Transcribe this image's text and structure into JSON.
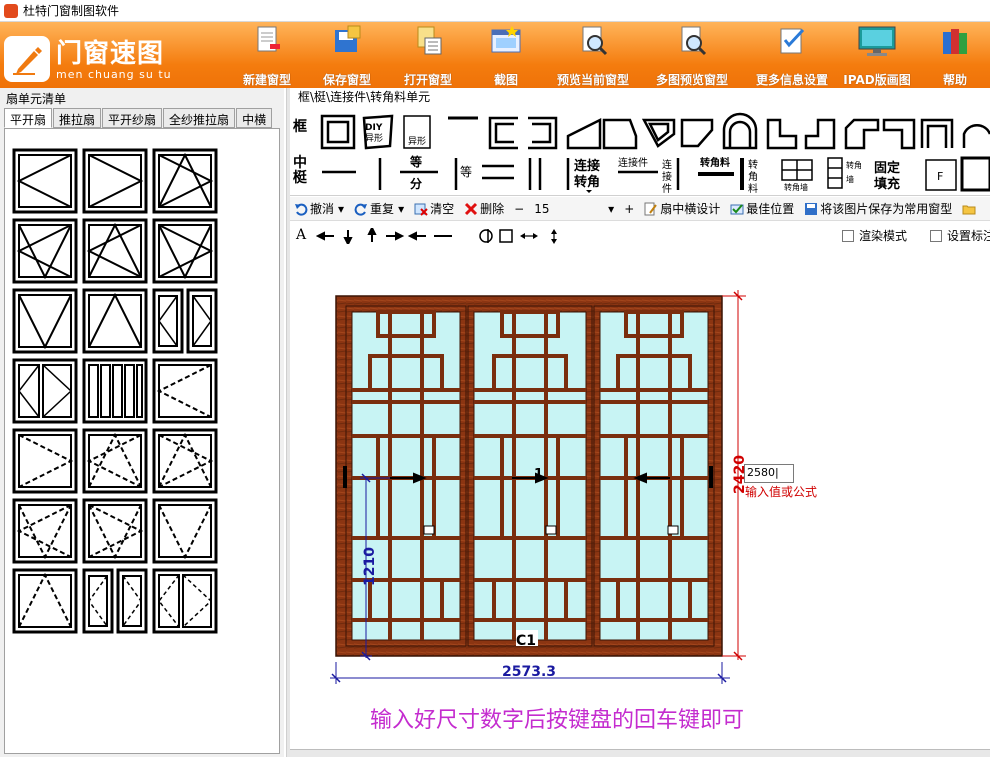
{
  "window": {
    "title": "杜特门窗制图软件"
  },
  "logo": {
    "cn": "门窗速图",
    "pinyin": "men chuang su tu"
  },
  "ribbon": [
    {
      "label": "新建窗型",
      "icon": "new-file-icon"
    },
    {
      "label": "保存窗型",
      "icon": "save-icon"
    },
    {
      "label": "打开窗型",
      "icon": "open-icon"
    },
    {
      "label": "截图",
      "icon": "screenshot-icon"
    },
    {
      "label": "预览当前窗型",
      "icon": "preview-icon"
    },
    {
      "label": "多图预览窗型",
      "icon": "multi-preview-icon"
    },
    {
      "label": "更多信息设置",
      "icon": "settings-icon"
    },
    {
      "label": "IPAD版画图",
      "icon": "ipad-icon"
    },
    {
      "label": "帮助",
      "icon": "help-books-icon"
    }
  ],
  "left": {
    "title": "扇单元清单",
    "tabs": [
      "平开扇",
      "推拉扇",
      "平开纱扇",
      "全纱推拉扇",
      "中横"
    ],
    "active_tab": 0
  },
  "profiles": {
    "title": "框\\梃\\连接件\\转角料单元",
    "row1_label": "框",
    "row2_label": "中梃",
    "diy_label": "DIY\n异形",
    "yixing_label": "异形",
    "deng_fen": "等分",
    "deng": "等",
    "lianjie_zhuanjiao": "连接转角",
    "lianjiejian": "连接件",
    "zhuanjiaoliao": "转角料",
    "zhuanjiaoqiang": "转角墙",
    "guding_tianchong": "固定填充",
    "f_label": "F"
  },
  "toolbar": {
    "undo": "撤消",
    "redo": "重复",
    "clear": "清空",
    "delete": "删除",
    "minus": "−",
    "value": "15",
    "plus": "+",
    "sash_design": "扇中横设计",
    "best_pos": "最佳位置",
    "save_common": "将该图片保存为常用窗型"
  },
  "drawtools": {
    "text_tool": "A",
    "render_mode": "渲染模式",
    "set_label": "设置标注"
  },
  "drawing": {
    "height_dim": "2420",
    "width_dim": "2573.3",
    "sash_dim": "1210",
    "input_value": "2580",
    "input_hint": "输入值或公式",
    "sash_mark": "1",
    "window_code": "C1",
    "instruction": "输入好尺寸数字后按键盘的回车键即可"
  },
  "colors": {
    "ribbon": "#f47c0e",
    "frame_wood": "#8b3512",
    "glass": "#c8f4f4",
    "dim_red": "#d00000",
    "dim_blue": "#1a1aa0",
    "instruction": "#c42ccf"
  }
}
